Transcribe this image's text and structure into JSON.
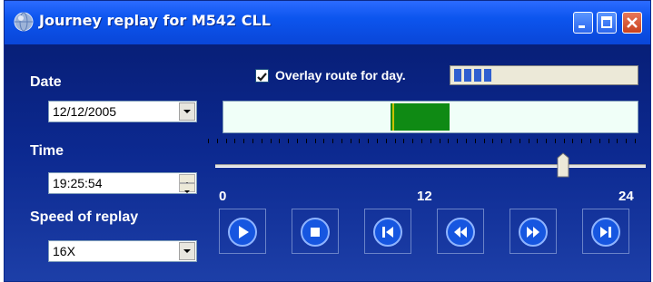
{
  "window": {
    "title": "Journey replay for M542 CLL",
    "title_icon": "globe-icon",
    "controls": [
      "minimize-icon",
      "maximize-icon",
      "close-icon"
    ]
  },
  "form": {
    "date_label": "Date",
    "date_value": "12/12/2005",
    "time_label": "Time",
    "time_value": "19:25:54",
    "speed_label": "Speed of replay",
    "speed_value": "16X"
  },
  "overlay": {
    "checked": true,
    "label": "Overlay route for day.",
    "progress_segments_filled": 4
  },
  "timeline": {
    "axis_labels": {
      "start": "0",
      "mid": "12",
      "end": "24"
    },
    "route_hours": [
      9.7,
      13.1
    ],
    "marker_hour": 9.8,
    "slider_hour": 19.43
  },
  "playback": {
    "buttons": [
      "play-icon",
      "stop-icon",
      "skip-to-start-icon",
      "rewind-icon",
      "fast-forward-icon",
      "skip-to-end-icon"
    ]
  },
  "colors": {
    "titlebar": "#0c55ee",
    "window_bg": "#0c2990",
    "route_green": "#0f8a14",
    "progress_blue": "#2f5fd0"
  }
}
